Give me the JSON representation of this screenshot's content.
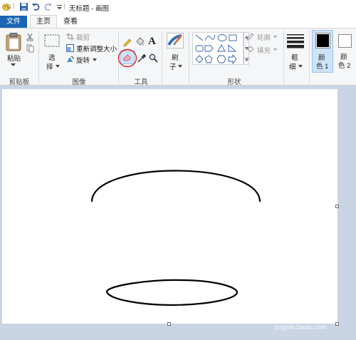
{
  "window": {
    "title": "无标题 - 画图"
  },
  "tabs": [
    {
      "label": "文件"
    },
    {
      "label": "主页"
    },
    {
      "label": "查看"
    }
  ],
  "clipboard": {
    "paste_label": "粘贴",
    "group_label": "剪贴板"
  },
  "image": {
    "select_label_line1": "选",
    "select_label_line2": "择",
    "crop_label": "裁剪",
    "resize_label": "重新调整大小",
    "rotate_label": "旋转",
    "group_label": "图像"
  },
  "tools": {
    "group_label": "工具"
  },
  "brush": {
    "label_line1": "刷",
    "label_line2": "子"
  },
  "shapes": {
    "outline_label": "轮廓",
    "fill_label": "填充",
    "group_label": "形状"
  },
  "size": {
    "label_line1": "粗",
    "label_line2": "细"
  },
  "color1": {
    "label_line1": "颜",
    "label_line2": "色 1",
    "swatch": "#000000"
  },
  "color2": {
    "label_line1": "颜",
    "label_line2": "色 2",
    "swatch": "#ffffff"
  },
  "watermark": {
    "text": "Bai 经验",
    "subtext": "jingyan.baidu.com"
  },
  "colors": {
    "accent": "#1a65b4",
    "workspace": "#c9d4e4",
    "highlight": "#dd2222"
  }
}
